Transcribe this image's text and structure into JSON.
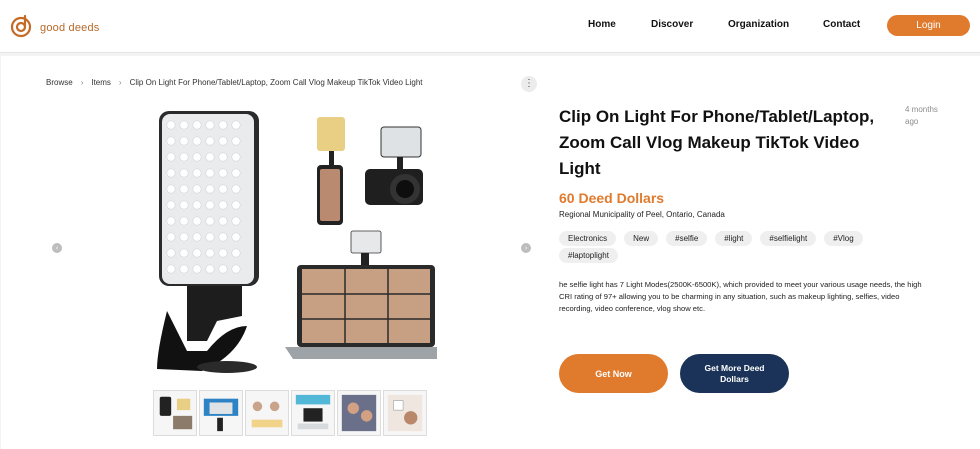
{
  "brand": {
    "name": "good deeds",
    "accent": "#e07a2d",
    "navy": "#1b3358"
  },
  "nav": {
    "home": "Home",
    "discover": "Discover",
    "organization": "Organization",
    "contact": "Contact",
    "login": "Login"
  },
  "breadcrumb": {
    "browse": "Browse",
    "items": "Items",
    "current": "Clip On Light For Phone/Tablet/Laptop, Zoom Call Vlog Makeup TikTok Video Light"
  },
  "gallery": {
    "main_image": "led-light-product-photo",
    "thumbnail_count": 6
  },
  "listing": {
    "title": "Clip On Light For Phone/Tablet/Laptop, Zoom Call Vlog Makeup TikTok Video Light",
    "posted": "4 months ago",
    "price": "60 Deed Dollars",
    "location": "Regional Municipality of Peel, Ontario, Canada",
    "tags": [
      "Electronics",
      "New",
      "#selfie",
      "#light",
      "#selfielight",
      "#Vlog",
      "#laptoplight"
    ],
    "description": "he selfie light has 7 Light Modes(2500K-6500K), which provided to meet your various usage needs, the high CRI rating of 97+ allowing you to be charming in any situation, such as makeup lighting, selfies, video recording, video conference, vlog show etc."
  },
  "actions": {
    "get_now": "Get Now",
    "get_more": "Get More Deed Dollars"
  }
}
